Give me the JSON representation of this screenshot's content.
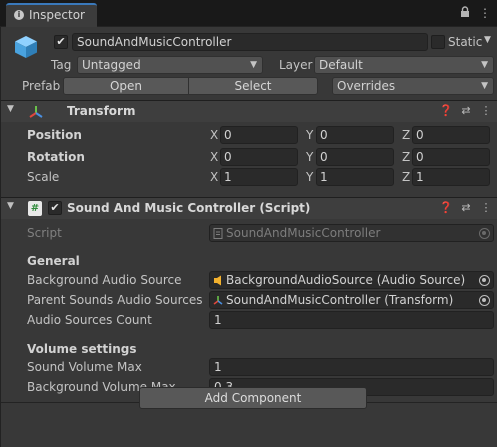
{
  "window": {
    "tab_title": "Inspector",
    "icons": [
      "info-icon",
      "lock-icon",
      "more-menu-icon"
    ]
  },
  "gameobject": {
    "name": "SoundAndMusicController",
    "active": true,
    "static_label": "Static",
    "static_checked": false,
    "tag_label": "Tag",
    "tag_value": "Untagged",
    "layer_label": "Layer",
    "layer_value": "Default",
    "prefab_label": "Prefab",
    "prefab_open": "Open",
    "prefab_select": "Select",
    "prefab_overrides": "Overrides"
  },
  "transform": {
    "title": "Transform",
    "rows": [
      {
        "label": "Position",
        "x": "0",
        "y": "0",
        "z": "0"
      },
      {
        "label": "Rotation",
        "x": "0",
        "y": "0",
        "z": "0"
      },
      {
        "label": "Scale",
        "x": "1",
        "y": "1",
        "z": "1"
      }
    ],
    "axis": {
      "x": "X",
      "y": "Y",
      "z": "Z"
    }
  },
  "script_component": {
    "title": "Sound And Music Controller (Script)",
    "enabled": true,
    "script_label": "Script",
    "script_value": "SoundAndMusicController",
    "general_header": "General",
    "bg_source_label": "Background Audio Source",
    "bg_source_value": "BackgroundAudioSource (Audio Source)",
    "parent_sounds_label": "Parent Sounds Audio Sources",
    "parent_sounds_value": "SoundAndMusicController (Transform)",
    "count_label": "Audio Sources Count",
    "count_value": "1",
    "volume_header": "Volume settings",
    "sound_max_label": "Sound Volume Max",
    "sound_max_value": "1",
    "bg_max_label": "Background Volume Max",
    "bg_max_value": "0.3"
  },
  "footer": {
    "add_component": "Add Component"
  },
  "colors": {
    "tab_accent": "#3a79bb",
    "cube_blue": "#4aa3df",
    "transform_gizmo": [
      "#e0473c",
      "#6ac24a",
      "#4a8ee0"
    ],
    "audio_source_icon": "#f2b12e"
  }
}
